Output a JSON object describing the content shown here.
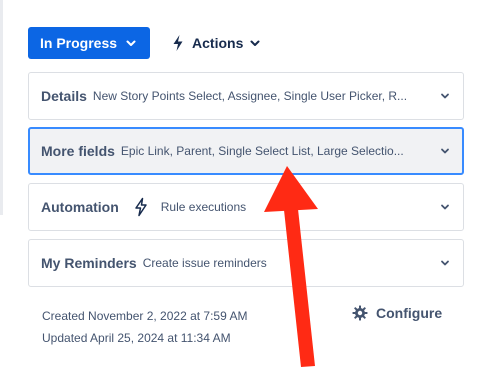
{
  "status_button": {
    "label": "In Progress",
    "icon": "chevron-down-icon",
    "color": "#0c66e4"
  },
  "actions_button": {
    "label": "Actions",
    "icon": "lightning-icon"
  },
  "panels": [
    {
      "title": "Details",
      "subtitle": "New Story Points Select, Assignee, Single User Picker, R..."
    },
    {
      "title": "More fields",
      "subtitle": "Epic Link, Parent, Single Select List, Large Selectio..."
    },
    {
      "title": "Automation",
      "subtitle": "Rule executions"
    },
    {
      "title": "My Reminders",
      "subtitle": "Create issue reminders"
    }
  ],
  "meta": {
    "created": "Created November 2, 2022 at 7:59 AM",
    "updated": "Updated April 25, 2024 at 11:34 AM"
  },
  "configure": {
    "label": "Configure",
    "icon": "gear-icon"
  },
  "annotation": {
    "type": "red-arrow",
    "color": "#ff2a14"
  }
}
